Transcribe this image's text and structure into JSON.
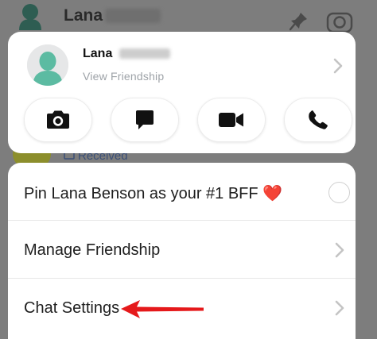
{
  "background": {
    "top_contact_name": "Lana",
    "received_label": "Received"
  },
  "profile": {
    "name": "Lana",
    "subtitle": "View Friendship"
  },
  "actions": [
    {
      "name": "camera-button",
      "icon": "camera-icon"
    },
    {
      "name": "chat-button",
      "icon": "chat-bubble-icon"
    },
    {
      "name": "video-call-button",
      "icon": "video-camera-icon"
    },
    {
      "name": "voice-call-button",
      "icon": "phone-icon"
    }
  ],
  "menu": {
    "pin_label": "Pin Lana Benson as your #1 BFF",
    "pin_emoji": "❤️",
    "manage_label": "Manage Friendship",
    "chat_settings_label": "Chat Settings"
  },
  "colors": {
    "overlay": "#7d7d7d",
    "avatar_teal": "#5cbba2",
    "annotation_arrow": "#e5191b"
  }
}
